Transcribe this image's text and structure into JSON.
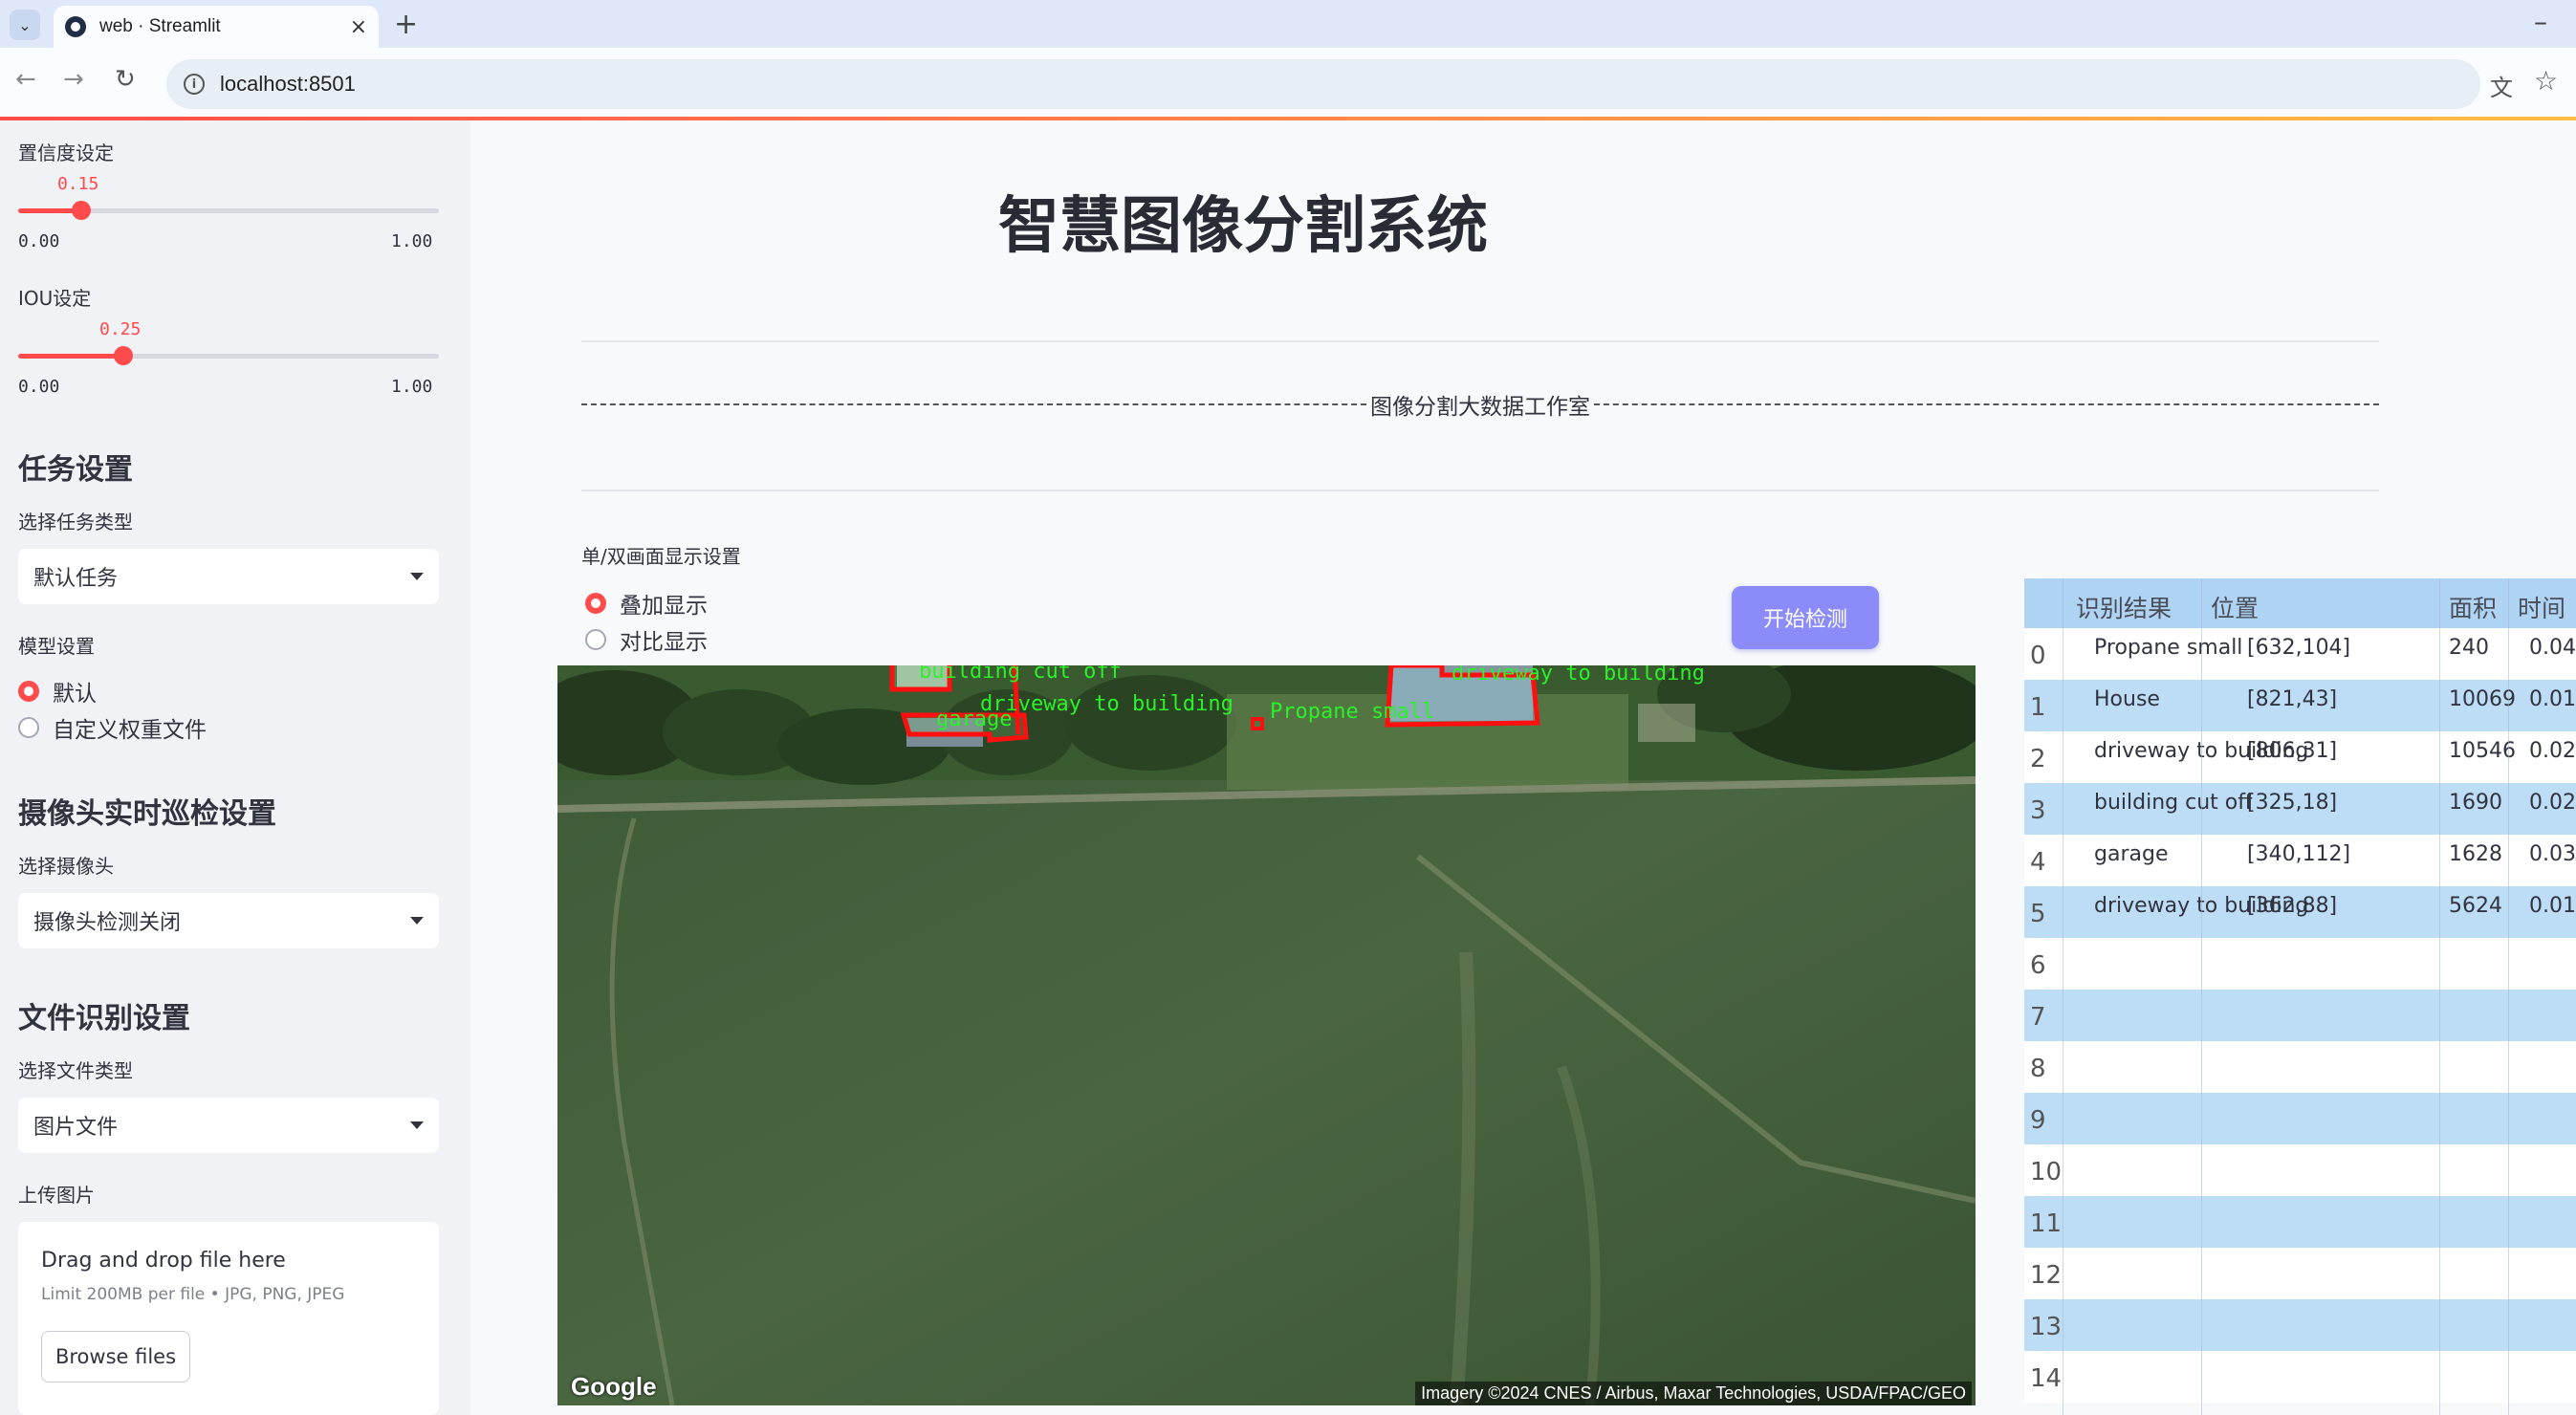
{
  "browser": {
    "tab_title": "web · Streamlit",
    "url": "localhost:8501"
  },
  "sidebar": {
    "confidence": {
      "label": "置信度设定",
      "value": 0.15,
      "value_text": "0.15",
      "min": "0.00",
      "max": "1.00"
    },
    "iou": {
      "label": "IOU设定",
      "value": 0.25,
      "value_text": "0.25",
      "min": "0.00",
      "max": "1.00"
    },
    "task_heading": "任务设置",
    "task_type_label": "选择任务类型",
    "task_type_value": "默认任务",
    "model_label": "模型设置",
    "model_options": [
      "默认",
      "自定义权重文件"
    ],
    "model_selected": "默认",
    "camera_heading": "摄像头实时巡检设置",
    "camera_label": "选择摄像头",
    "camera_value": "摄像头检测关闭",
    "file_heading": "文件识别设置",
    "file_type_label": "选择文件类型",
    "file_type_value": "图片文件",
    "upload_label": "上传图片",
    "upload_title": "Drag and drop file here",
    "upload_limit": "Limit 200MB per file • JPG, PNG, JPEG",
    "upload_button": "Browse files"
  },
  "main": {
    "title": "智慧图像分割系统",
    "subtitle": "图像分割大数据工作室",
    "display_label": "单/双画面显示设置",
    "display_options": [
      "叠加显示",
      "对比显示"
    ],
    "display_selected": "叠加显示",
    "detect_button": "开始检测",
    "image_logo": "Google",
    "image_credit": "Imagery ©2024 CNES / Airbus, Maxar Technologies, USDA/FPAC/GEO",
    "detection_labels": [
      "building cut off",
      "driveway to building",
      "garage",
      "Propane small",
      "driveway to building"
    ]
  },
  "results_table": {
    "headers": [
      "识别结果",
      "位置",
      "面积",
      "时间"
    ],
    "rows": [
      {
        "index": "0",
        "name": "Propane small",
        "position": "[632,104]",
        "area": "240",
        "time": "0.04"
      },
      {
        "index": "1",
        "name": "House",
        "position": "[821,43]",
        "area": "10069",
        "time": "0.01"
      },
      {
        "index": "2",
        "name": "driveway to building",
        "position": "[806,31]",
        "area": "10546",
        "time": "0.02"
      },
      {
        "index": "3",
        "name": "building cut off",
        "position": "[325,18]",
        "area": "1690",
        "time": "0.02"
      },
      {
        "index": "4",
        "name": "garage",
        "position": "[340,112]",
        "area": "1628",
        "time": "0.03"
      },
      {
        "index": "5",
        "name": "driveway to building",
        "position": "[362,88]",
        "area": "5624",
        "time": "0.01"
      }
    ],
    "empty_indices": [
      "6",
      "7",
      "8",
      "9",
      "10",
      "11",
      "12",
      "13",
      "14"
    ]
  }
}
